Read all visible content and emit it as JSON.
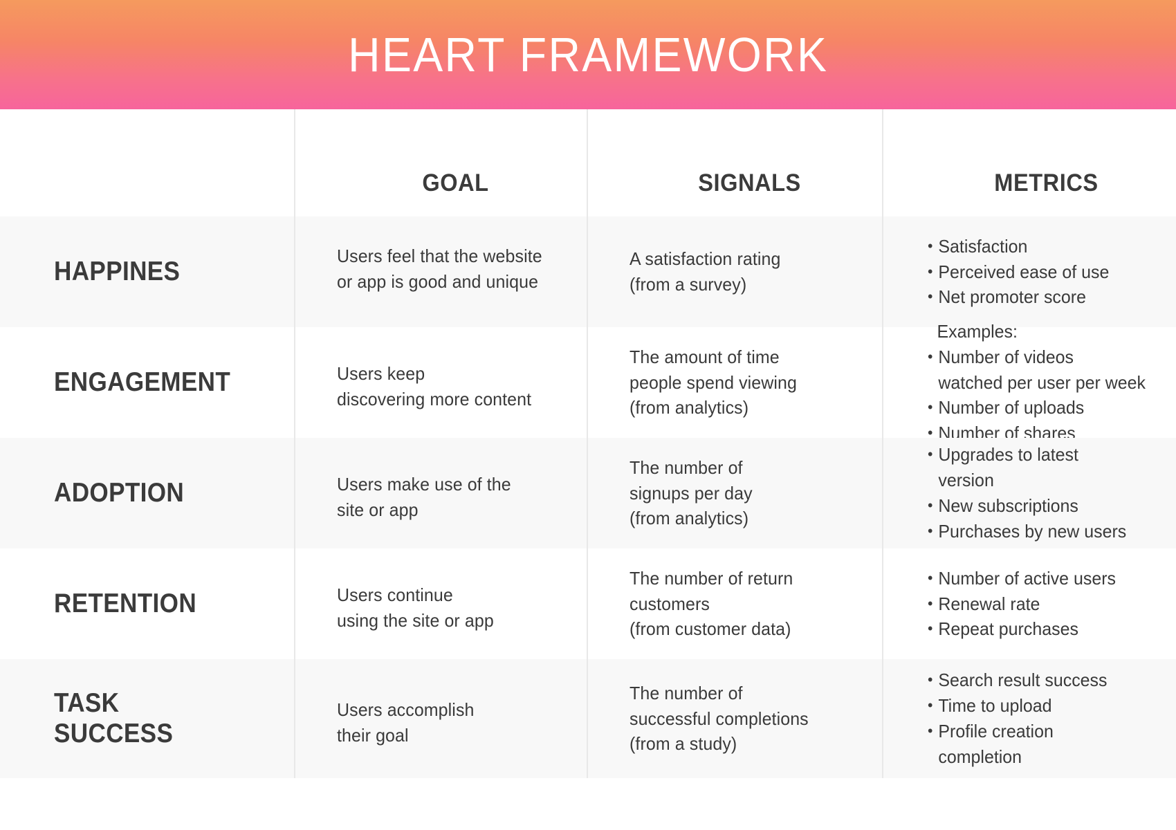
{
  "header": {
    "title": "HEART FRAMEWORK",
    "gradient_from": "#F59A5E",
    "gradient_to": "#F7649C"
  },
  "table": {
    "columns": [
      {
        "key": "dimension",
        "label": ""
      },
      {
        "key": "goal",
        "label": "GOAL"
      },
      {
        "key": "signals",
        "label": "SIGNALS"
      },
      {
        "key": "metrics",
        "label": "METRICS"
      }
    ],
    "rows": [
      {
        "dimension": "HAPPINES",
        "goal": "Users feel that the website\nor app is good and unique",
        "signals": "A satisfaction rating\n(from a survey)",
        "metrics_note": "",
        "metrics": [
          "Satisfaction",
          "Perceived ease of use",
          "Net promoter score"
        ]
      },
      {
        "dimension": "ENGAGEMENT",
        "goal": "Users keep\ndiscovering more content",
        "signals": "The amount of time\npeople spend viewing\n(from analytics)",
        "metrics_note": "Examples:",
        "metrics": [
          "Number of videos\nwatched per user per week",
          "Number of uploads",
          "Number of shares"
        ]
      },
      {
        "dimension": "ADOPTION",
        "goal": "Users make use of the\nsite or app",
        "signals": "The number of\nsignups per day\n(from analytics)",
        "metrics_note": "",
        "metrics": [
          "Upgrades to latest\nversion",
          "New subscriptions",
          "Purchases by new users"
        ]
      },
      {
        "dimension": "RETENTION",
        "goal": "Users continue\nusing the site or app",
        "signals": "The number of return\ncustomers\n(from customer data)",
        "metrics_note": "",
        "metrics": [
          "Number of active users",
          "Renewal rate",
          "Repeat purchases"
        ]
      },
      {
        "dimension": "TASK\nSUCCESS",
        "goal": "Users accomplish\ntheir goal",
        "signals": "The number of\nsuccessful completions\n(from a study)",
        "metrics_note": "",
        "metrics": [
          "Search result success",
          "Time to upload",
          "Profile creation\ncompletion"
        ]
      }
    ]
  },
  "colors": {
    "band_gray": "#F8F8F8",
    "band_white": "#FFFFFF",
    "divider": "#E8E8E8",
    "text": "#3A3A3A"
  }
}
